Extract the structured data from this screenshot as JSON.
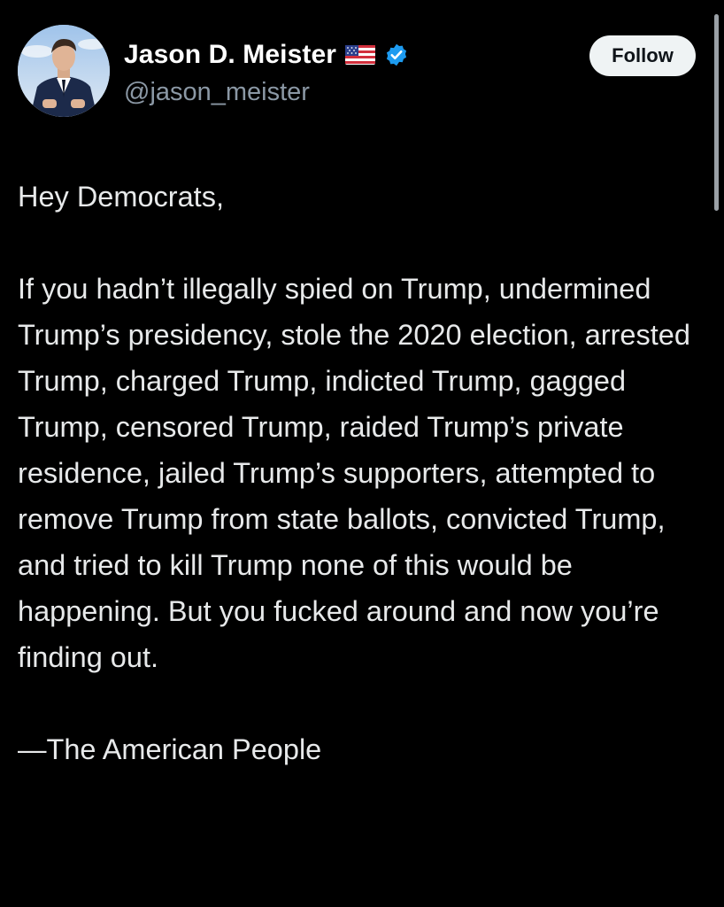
{
  "author": {
    "display_name": "Jason D. Meister",
    "handle": "@jason_meister",
    "flag_icon": "us-flag-icon",
    "verified_icon": "verified-badge-icon",
    "verified_color": "#1d9bf0"
  },
  "actions": {
    "follow_label": "Follow"
  },
  "tweet": {
    "greeting": "Hey Democrats,",
    "body": "If you hadn’t illegally spied on Trump, undermined Trump’s presidency, stole the 2020 election, arrested Trump, charged Trump, indicted Trump, gagged Trump, censored Trump, raided Trump’s private residence, jailed Trump’s supporters, attempted to remove Trump from state ballots, convicted Trump, and tried to kill Trump none of this would be happening. But you fucked around and now you’re finding out.",
    "signature": "—The American People"
  },
  "colors": {
    "background": "#000000",
    "text": "#e7e9ea",
    "secondary_text": "#8b98a5",
    "follow_bg": "#eff3f4"
  }
}
